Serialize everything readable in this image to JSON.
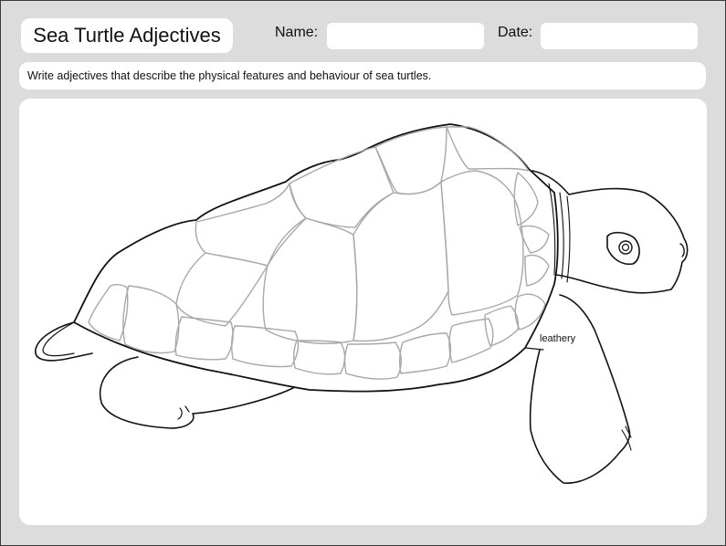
{
  "worksheet": {
    "title": "Sea Turtle Adjectives",
    "name_label": "Name:",
    "date_label": "Date:",
    "instructions": "Write adjectives that describe the physical features and behaviour of sea turtles."
  },
  "illustration": {
    "labels": [
      {
        "text": "leathery"
      }
    ]
  }
}
